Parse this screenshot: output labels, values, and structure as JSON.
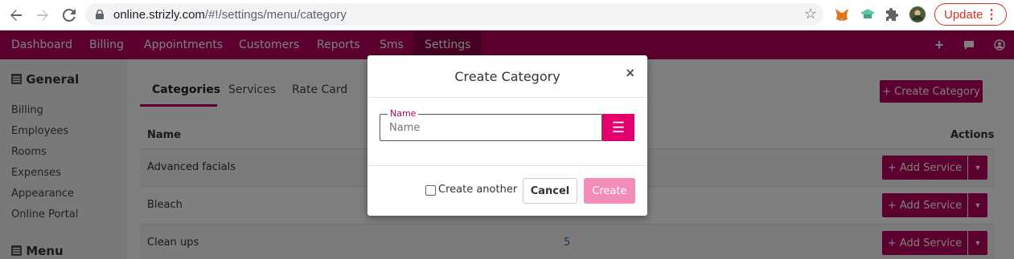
{
  "browser": {
    "url_host": "online.strizly.com",
    "url_path": "/#!/settings/menu/category",
    "update_label": "Update"
  },
  "navbar": {
    "items": [
      {
        "label": "Dashboard"
      },
      {
        "label": "Billing"
      },
      {
        "label": "Appointments"
      },
      {
        "label": "Customers"
      },
      {
        "label": "Reports"
      },
      {
        "label": "Sms"
      },
      {
        "label": "Settings"
      }
    ],
    "active": "Settings"
  },
  "sidebar": {
    "general_heading": "General",
    "items": [
      "Billing",
      "Employees",
      "Rooms",
      "Expenses",
      "Appearance",
      "Online Portal"
    ],
    "menu_heading": "Menu"
  },
  "tabs": [
    {
      "label": "Categories"
    },
    {
      "label": "Services"
    },
    {
      "label": "Rate Card"
    }
  ],
  "create_category_label": "+ Create Category",
  "table": {
    "headers": {
      "name": "Name",
      "actions": "Actions"
    },
    "rows": [
      {
        "name": "Advanced facials",
        "count": ""
      },
      {
        "name": "Bleach",
        "count": ""
      },
      {
        "name": "Clean ups",
        "count": "5"
      }
    ],
    "add_service_label": "+ Add Service"
  },
  "modal": {
    "title": "Create Category",
    "close": "×",
    "field_label": "Name",
    "field_placeholder": "Name",
    "create_another": "Create another",
    "cancel": "Cancel",
    "create": "Create"
  }
}
